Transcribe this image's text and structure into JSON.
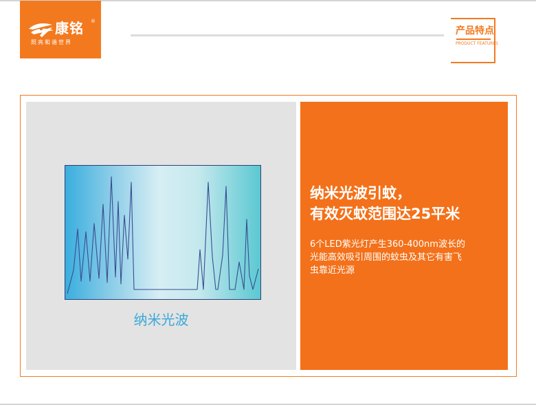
{
  "brand": {
    "name": "康铭",
    "registered_mark": "®",
    "slogan": "照亮和谐世界",
    "color": "#f3791f",
    "logo_icon": "leaf-burst-logo-icon"
  },
  "section": {
    "title": "产品特点",
    "subtitle": "PRODUCT FEATURES"
  },
  "illustration": {
    "caption": "纳米光波",
    "line_color": "#3a4b90"
  },
  "feature": {
    "headline_lines": [
      "纳米光波引蚊，",
      "有效灭蚊范围达25平米"
    ],
    "body_lines": [
      "6个LED紫光灯产生360-400nm波长的",
      "光能高效吸引周围的蚊虫及其它有害飞",
      "虫靠近光源"
    ],
    "panel_color": "#f3711a"
  }
}
